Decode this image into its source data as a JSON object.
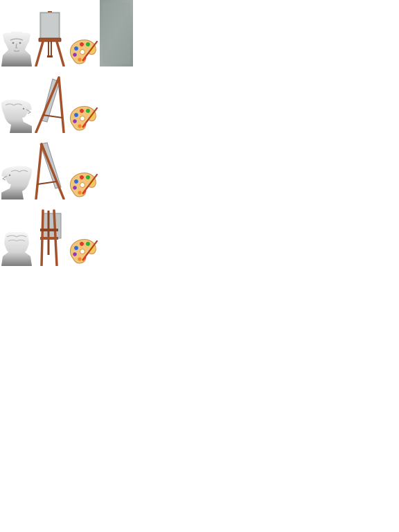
{
  "sheet": {
    "kind": "sprite-tileset",
    "rows": [
      {
        "bust_view": "front",
        "easel_view": "front-with-canvas",
        "palette": "paint-palette-icon"
      },
      {
        "bust_view": "right-profile",
        "easel_view": "side-folded",
        "palette": "paint-palette-icon"
      },
      {
        "bust_view": "left-profile",
        "easel_view": "side-folded",
        "palette": "paint-palette-icon"
      },
      {
        "bust_view": "back",
        "easel_view": "back",
        "palette": "paint-palette-icon"
      }
    ],
    "extra_tile": "grey-canvas-texture"
  },
  "colors": {
    "background": "#ffffff",
    "marble_light": "#f2f2f2",
    "marble_mid": "#c9c9c9",
    "marble_dark": "#7d7d7d",
    "wood": "#a4522c",
    "wood_dark": "#6e2f15",
    "canvas_grey": "#b9bcbc",
    "swatch_grey": "#97a19d",
    "palette_wood": "#f2c57a"
  }
}
